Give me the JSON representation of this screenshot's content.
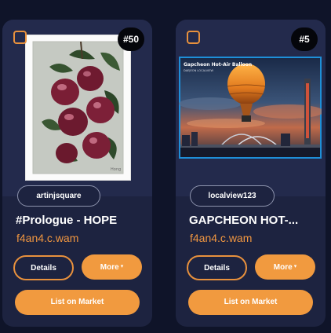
{
  "cards": [
    {
      "badge": "#50",
      "creator": "artinjsquare",
      "title": "#Prologue - HOPE",
      "collection": "f4an4.c.wam",
      "details_label": "Details",
      "more_label": "More",
      "more_caret": "▾",
      "list_label": "List on Market",
      "artwork": {
        "signature": "Hong"
      }
    },
    {
      "badge": "#5",
      "creator": "localview123",
      "title": "GAPCHEON HOT-...",
      "collection": "f4an4.c.wam",
      "details_label": "Details",
      "more_label": "More",
      "more_caret": "▾",
      "list_label": "List on Market",
      "artwork": {
        "heading": "Gapcheon Hot-Air Balloon",
        "subheading": "DAEJEON LOCALVIEW"
      }
    }
  ],
  "colors": {
    "background": "#0f1429",
    "card": "#1d2340",
    "accent": "#f19a3f",
    "link": "#f09640"
  }
}
